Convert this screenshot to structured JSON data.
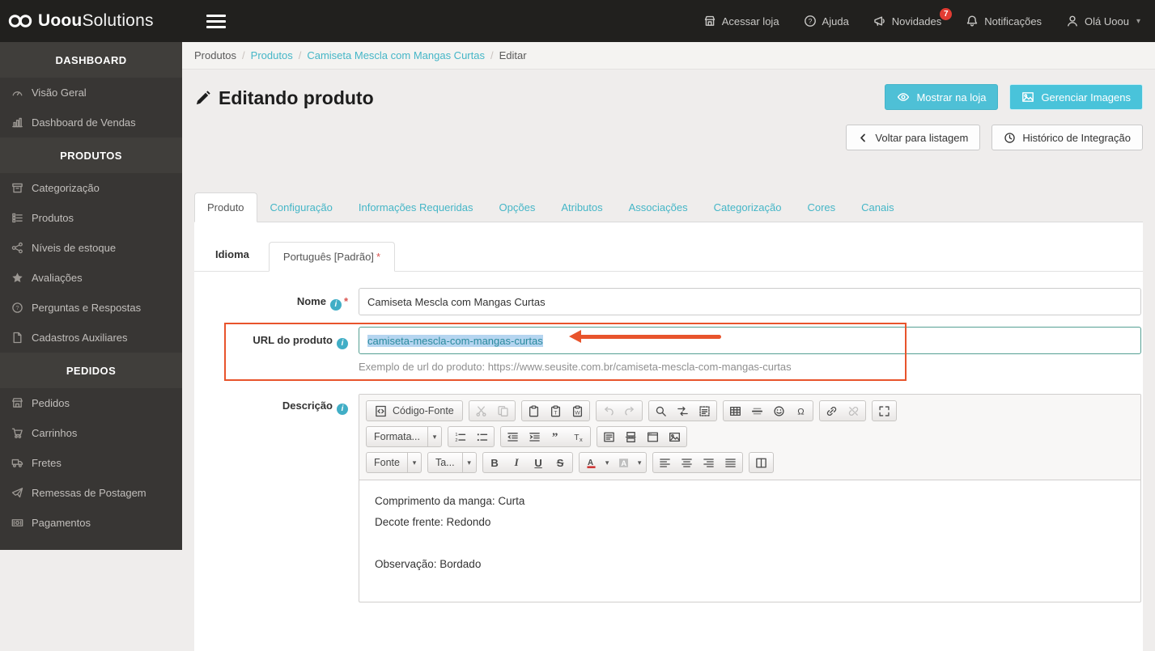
{
  "topbar": {
    "brand_bold": "Uoou",
    "brand_light": "Solutions",
    "menu": [
      {
        "label": "Acessar loja",
        "icon": "storefront-icon"
      },
      {
        "label": "Ajuda",
        "icon": "help-icon"
      },
      {
        "label": "Novidades",
        "icon": "megaphone-icon",
        "badge": "7"
      },
      {
        "label": "Notificações",
        "icon": "bell-icon"
      },
      {
        "label": "Olá Uoou",
        "icon": "user-icon"
      }
    ]
  },
  "sidebar": {
    "sections": [
      {
        "header": "DASHBOARD",
        "items": [
          {
            "label": "Visão Geral",
            "icon": "gauge-icon"
          },
          {
            "label": "Dashboard de Vendas",
            "icon": "bar-chart-icon"
          }
        ]
      },
      {
        "header": "PRODUTOS",
        "items": [
          {
            "label": "Categorização",
            "icon": "archive-icon"
          },
          {
            "label": "Produtos",
            "icon": "list-icon"
          },
          {
            "label": "Níveis de estoque",
            "icon": "share-icon"
          },
          {
            "label": "Avaliações",
            "icon": "star-icon"
          },
          {
            "label": "Perguntas e Respostas",
            "icon": "question-icon"
          },
          {
            "label": "Cadastros Auxiliares",
            "icon": "file-icon"
          }
        ]
      },
      {
        "header": "PEDIDOS",
        "items": [
          {
            "label": "Pedidos",
            "icon": "shop-icon"
          },
          {
            "label": "Carrinhos",
            "icon": "cart-icon"
          },
          {
            "label": "Fretes",
            "icon": "truck-icon"
          },
          {
            "label": "Remessas de Postagem",
            "icon": "send-icon"
          },
          {
            "label": "Pagamentos",
            "icon": "money-icon"
          }
        ]
      }
    ]
  },
  "breadcrumb": {
    "items": [
      "Produtos",
      "Produtos",
      "Camiseta Mescla com Mangas Curtas",
      "Editar"
    ],
    "separator": "/"
  },
  "page": {
    "title": "Editando produto"
  },
  "actions": {
    "show_in_store": "Mostrar na loja",
    "manage_images": "Gerenciar Imagens",
    "back_to_list": "Voltar para listagem",
    "integration_history": "Histórico de Integração"
  },
  "tabs": [
    "Produto",
    "Configuração",
    "Informações Requeridas",
    "Opções",
    "Atributos",
    "Associações",
    "Categorização",
    "Cores",
    "Canais"
  ],
  "language": {
    "label": "Idioma",
    "active_tab": "Português [Padrão]",
    "required_mark": "*"
  },
  "form": {
    "name": {
      "label": "Nome",
      "required_mark": "*",
      "value": "Camiseta Mescla com Mangas Curtas"
    },
    "url": {
      "label": "URL do produto",
      "value": "camiseta-mescla-com-mangas-curtas",
      "help": "Exemplo de url do produto: https://www.seusite.com.br/camiseta-mescla-com-mangas-curtas"
    },
    "description": {
      "label": "Descrição",
      "lines": [
        "Comprimento da manga: Curta",
        "Decote frente: Redondo",
        "",
        "Observação: Bordado"
      ]
    }
  },
  "editor": {
    "source_label": "Código-Fonte",
    "format_label": "Formata...",
    "font_label": "Fonte",
    "size_label": "Ta...",
    "bold": "B",
    "italic": "I",
    "underline": "U",
    "strike": "S"
  },
  "icons": {
    "caret_down": "▾",
    "omega": "Ω",
    "quote": "”",
    "color_letter": "A",
    "question_mark": "?",
    "info_letter": "i",
    "letter_t": "T",
    "letter_w": "W",
    "num1": "1",
    "num2": "2",
    "remove_t": "T",
    "remove_x": "x"
  },
  "colors": {
    "accent_teal": "#45b6c7",
    "button_cyan": "#4ec0d6",
    "annotation_orange": "#e8542c",
    "badge_red": "#e23c33",
    "selection_blue": "#b5d5f0",
    "url_focus_border": "#55a093"
  }
}
